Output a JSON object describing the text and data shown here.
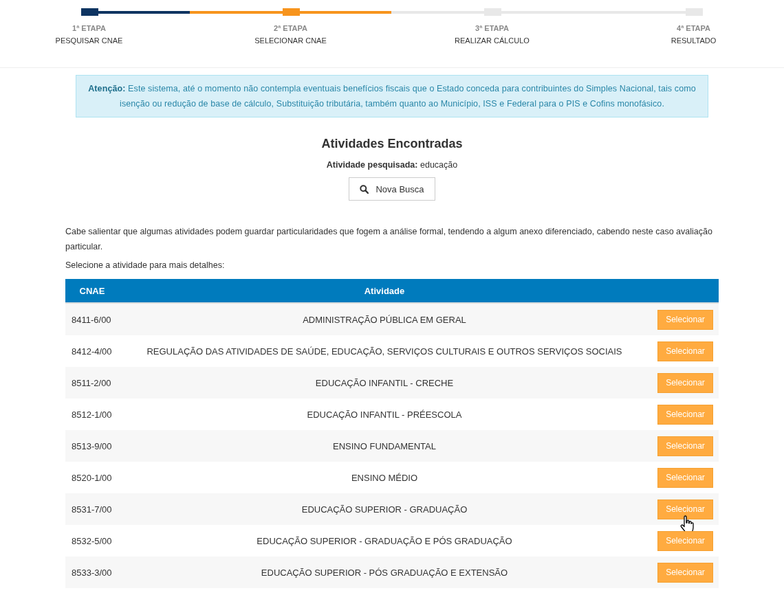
{
  "steps": [
    {
      "number": "1ª ETAPA",
      "label": "PESQUISAR CNAE",
      "completed": true,
      "selected": false
    },
    {
      "number": "2ª ETAPA",
      "label": "SELECIONAR CNAE",
      "completed": false,
      "selected": true
    },
    {
      "number": "3ª ETAPA",
      "label": "REALIZAR CÁLCULO",
      "completed": false,
      "selected": false
    },
    {
      "number": "4ª ETAPA",
      "label": "RESULTADO",
      "completed": false,
      "selected": false
    }
  ],
  "alert": "**Atenção:** Este sistema, até o momento não contempla eventuais benefícios fiscais que o Estado conceda para contribuintes do Simples Nacional, tais como isenção ou redução de base de cálculo, Substituição tributária, também quanto ao Município, ISS e Federal para o PIS e Cofins monofásico.",
  "title": "Atividades Encontradas",
  "searched": "**Atividade pesquisada:** educação",
  "new_search_button": "Nova Busca",
  "note": "Cabe salientar que algumas atividades podem guardar particularidades que fogem a análise formal, tendendo a algum anexo diferenciado, cabendo neste caso avaliação particular.",
  "instruction": "Selecione a atividade para mais detalhes:",
  "table": {
    "columns": [
      "CNAE",
      "Atividade"
    ],
    "rows": [
      {
        "cnae": "8411-6/00",
        "activity": "ADMINISTRAÇÃO PÚBLICA EM GERAL",
        "button": "Selecionar",
        "pointer": false
      },
      {
        "cnae": "8412-4/00",
        "activity": "REGULAÇÃO DAS ATIVIDADES DE SAÚDE, EDUCAÇÃO, SERVIÇOS CULTURAIS E OUTROS SERVIÇOS SOCIAIS",
        "button": "Selecionar",
        "pointer": false
      },
      {
        "cnae": "8511-2/00",
        "activity": "EDUCAÇÃO INFANTIL - CRECHE",
        "button": "Selecionar",
        "pointer": false
      },
      {
        "cnae": "8512-1/00",
        "activity": "EDUCAÇÃO INFANTIL - PRÉESCOLA",
        "button": "Selecionar",
        "pointer": false
      },
      {
        "cnae": "8513-9/00",
        "activity": "ENSINO FUNDAMENTAL",
        "button": "Selecionar",
        "pointer": false
      },
      {
        "cnae": "8520-1/00",
        "activity": "ENSINO MÉDIO",
        "button": "Selecionar",
        "pointer": false
      },
      {
        "cnae": "8531-7/00",
        "activity": "EDUCAÇÃO SUPERIOR - GRADUAÇÃO",
        "button": "Selecionar",
        "pointer": true
      },
      {
        "cnae": "8532-5/00",
        "activity": "EDUCAÇÃO SUPERIOR - GRADUAÇÃO E PÓS GRADUAÇÃO",
        "button": "Selecionar",
        "pointer": false
      },
      {
        "cnae": "8533-3/00",
        "activity": "EDUCAÇÃO SUPERIOR - PÓS GRADUAÇÃO E EXTENSÃO",
        "button": "Selecionar",
        "pointer": false
      }
    ]
  }
}
